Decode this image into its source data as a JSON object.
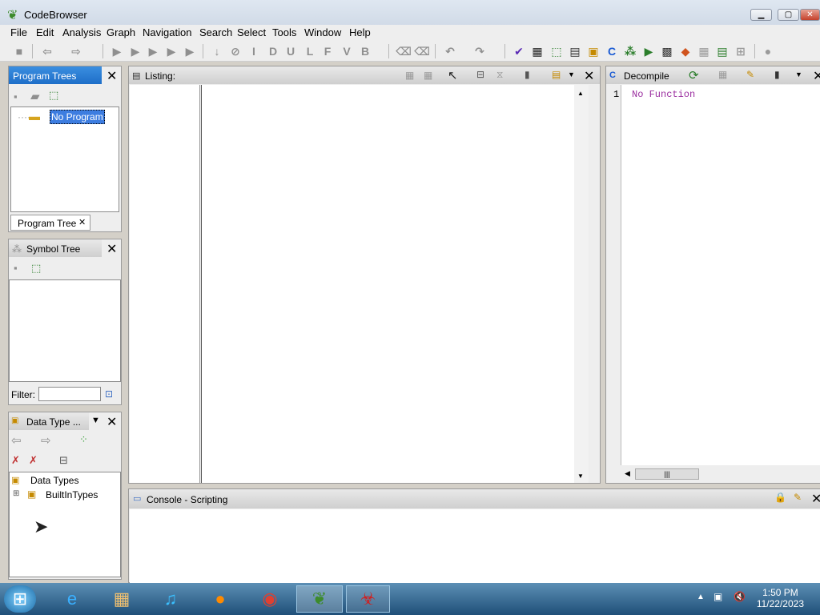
{
  "window": {
    "title": "CodeBrowser"
  },
  "menu": [
    "File",
    "Edit",
    "Analysis",
    "Graph",
    "Navigation",
    "Search",
    "Select",
    "Tools",
    "Window",
    "Help"
  ],
  "program_trees": {
    "title": "Program Trees",
    "node": "No Program",
    "tab": "Program Tree"
  },
  "symbol_tree": {
    "title": "Symbol Tree",
    "filter_label": "Filter:"
  },
  "data_types": {
    "title": "Data Type ...",
    "root": "Data Types",
    "child": "BuiltInTypes"
  },
  "listing": {
    "title": "Listing:"
  },
  "decompile": {
    "title": "Decompile",
    "line_number": "1",
    "content": "No Function"
  },
  "console": {
    "title": "Console - Scripting"
  },
  "taskbar": {
    "time": "1:50 PM",
    "date": "11/22/2023"
  },
  "colors": {
    "accent": "#1e6ec8",
    "decomp_text": "#9b2fa0"
  }
}
